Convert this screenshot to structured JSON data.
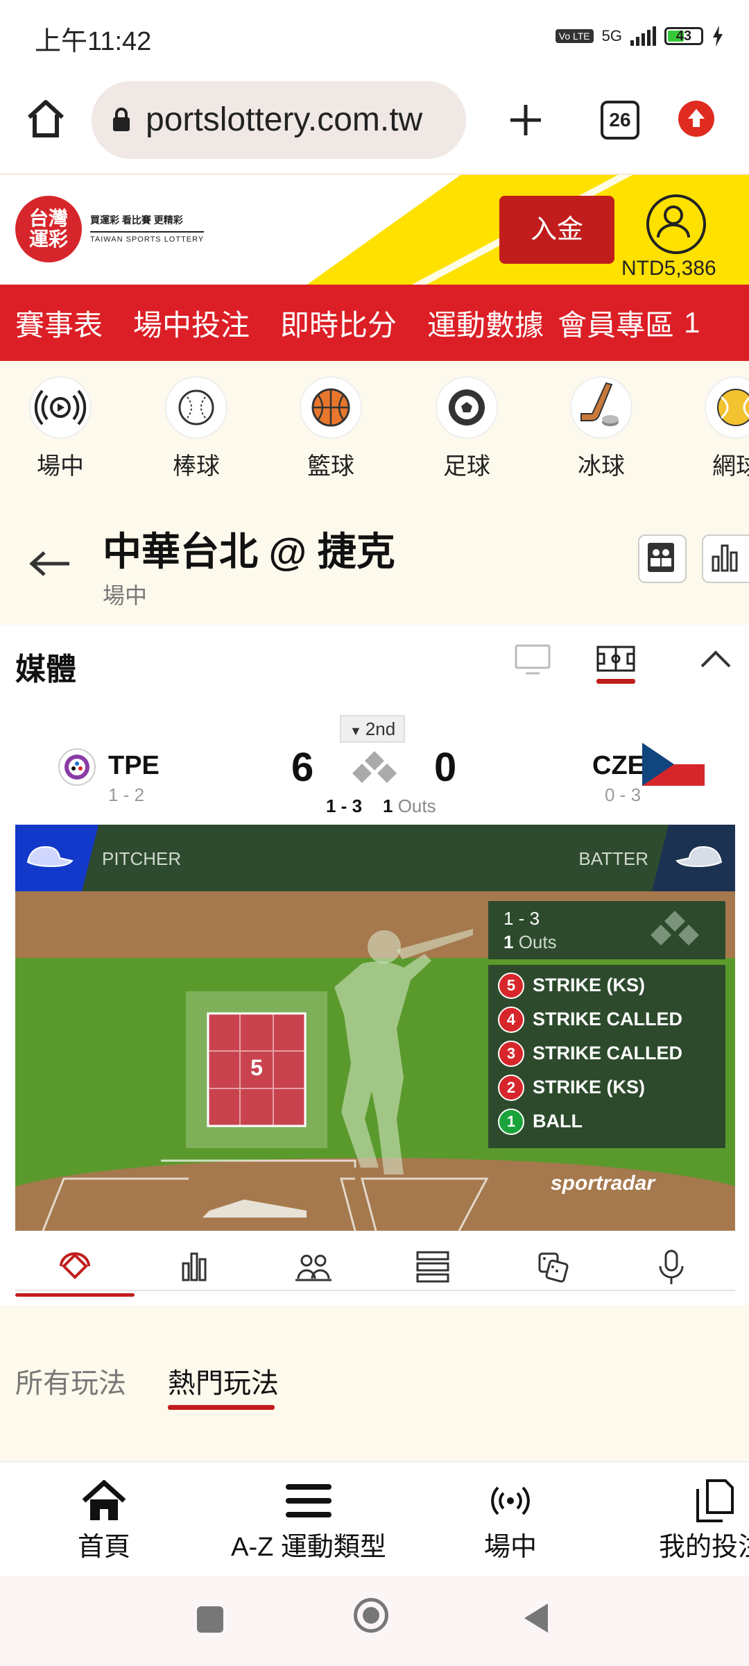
{
  "status_bar": {
    "time": "上午11:42",
    "network": "5G",
    "battery": "43",
    "volte": "Vo LTE"
  },
  "browser": {
    "url": "portslottery.com.tw",
    "tab_count": "26"
  },
  "site_header": {
    "logo_text_top": "台灣",
    "logo_text_bottom": "運彩",
    "slogan": "買運彩 看比賽 更精彩",
    "slogan_en": "TAIWAN SPORTS LOTTERY",
    "deposit_label": "入金",
    "balance": "NTD5,386",
    "accent_color": "#dc1f26",
    "band_color": "#ffe100"
  },
  "main_nav": [
    "賽事表",
    "場中投注",
    "即時比分",
    "運動數據",
    "會員專區",
    "1"
  ],
  "sports": [
    {
      "label": "場中",
      "icon": "live-icon"
    },
    {
      "label": "棒球",
      "icon": "baseball-icon"
    },
    {
      "label": "籃球",
      "icon": "basketball-icon"
    },
    {
      "label": "足球",
      "icon": "soccer-icon"
    },
    {
      "label": "冰球",
      "icon": "ice-hockey-icon"
    },
    {
      "label": "網球",
      "icon": "tennis-icon"
    }
  ],
  "match": {
    "title": "中華台北 @ 捷克",
    "status": "場中"
  },
  "media": {
    "label": "媒體",
    "inning": "2nd",
    "home": {
      "code": "TPE",
      "record": "1 - 2",
      "score": "6"
    },
    "away": {
      "code": "CZE",
      "record": "0 - 3",
      "score": "0"
    },
    "count": "1 - 3",
    "outs_num": "1",
    "outs_label": "Outs",
    "pitcher_label": "PITCHER",
    "batter_label": "BATTER",
    "zone_number": "5",
    "provider": "sportradar",
    "pitches": [
      {
        "num": "5",
        "label": "STRIKE (KS)",
        "color": "#d7262b"
      },
      {
        "num": "4",
        "label": "STRIKE CALLED",
        "color": "#d7262b"
      },
      {
        "num": "3",
        "label": "STRIKE CALLED",
        "color": "#d7262b"
      },
      {
        "num": "2",
        "label": "STRIKE (KS)",
        "color": "#d7262b"
      },
      {
        "num": "1",
        "label": "BALL",
        "color": "#1aa33a"
      }
    ]
  },
  "bet_tabs": [
    "所有玩法",
    "熱門玩法"
  ],
  "bottom_nav": [
    {
      "label": "首頁",
      "icon": "home-icon"
    },
    {
      "label": "A-Z 運動類型",
      "icon": "menu-icon"
    },
    {
      "label": "場中",
      "icon": "live-icon"
    },
    {
      "label": "我的投注",
      "icon": "bets-icon"
    }
  ]
}
